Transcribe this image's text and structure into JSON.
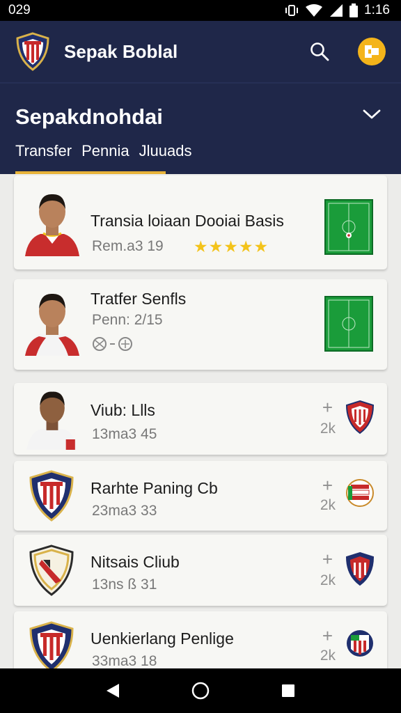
{
  "status_bar": {
    "left_text": "029",
    "time": "1:16"
  },
  "app_bar": {
    "title": "Sepak Boblal"
  },
  "header": {
    "title": "Sepakdnohdai",
    "tabs": [
      "Transfer",
      "Pennia",
      "Jluuads"
    ]
  },
  "cards": [
    {
      "title": "Transia loiaan Dooiai Basis",
      "subtitle": "Rem.a3  19",
      "stars": "★★★★★"
    },
    {
      "title": "Tratfer Senfls",
      "subtitle": "Penn: 2/15"
    },
    {
      "title": "Viub: Llls",
      "subtitle": "13ma3  45",
      "plus": "+",
      "count": "2k"
    },
    {
      "title": "Rarhte Paning Cb",
      "subtitle": "23ma3  33",
      "plus": "+",
      "count": "2k"
    },
    {
      "title": "Nitsais Cliub",
      "subtitle": "13ns  ß  31",
      "plus": "+",
      "count": "2k"
    },
    {
      "title": "Uenkierlang Penlige",
      "subtitle": "33ma3  18",
      "plus": "+",
      "count": "2k"
    }
  ],
  "colors": {
    "brand_navy": "#1f2749",
    "accent_yellow": "#f4b41a",
    "star_gold": "#f3c31a",
    "pitch_green": "#1a9c3a",
    "crest_red": "#c72a2a"
  },
  "icons": [
    "search-icon",
    "profile-icon",
    "chevron-down-icon",
    "back-icon",
    "home-icon",
    "recents-icon"
  ]
}
